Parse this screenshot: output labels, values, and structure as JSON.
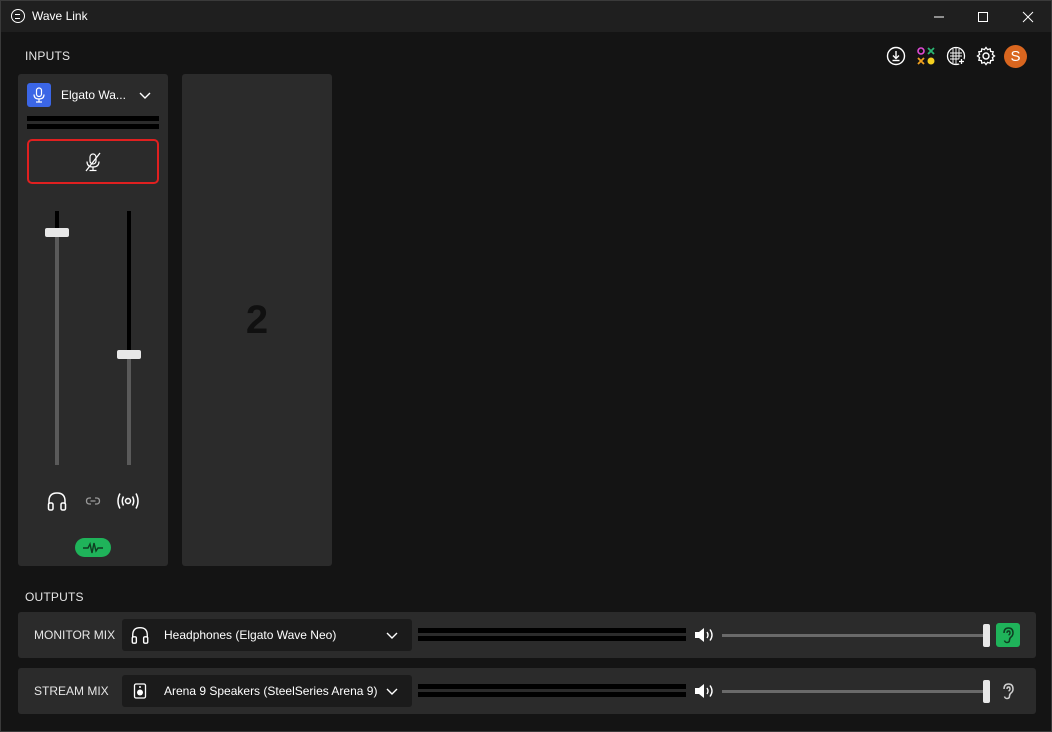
{
  "window": {
    "title": "Wave Link",
    "minimize_icon": "minimize-icon",
    "maximize_icon": "maximize-icon",
    "close_icon": "close-icon"
  },
  "inputs": {
    "section_label": "INPUTS",
    "channels": [
      {
        "name": "Elgato Wa...",
        "icon": "microphone-icon",
        "icon_color": "#3b66e6",
        "muted": true,
        "mute_border_color": "#e02020",
        "monitor_level": 0.92,
        "stream_level": 0.43,
        "monitor_icon": "headphones-icon",
        "link_icon": "link-icon",
        "stream_icon": "broadcast-icon",
        "effects_icon": "waveform-icon",
        "effects_color": "#1fb35a"
      }
    ],
    "empty_slot_label": "2"
  },
  "toolbar": {
    "icons": [
      "download-icon",
      "marketplace-icon",
      "add-input-icon",
      "settings-icon"
    ],
    "avatar_initial": "S",
    "avatar_color": "#d9661f"
  },
  "outputs": {
    "section_label": "OUTPUTS",
    "mixes": [
      {
        "label": "MONITOR MIX",
        "device": "Headphones (Elgato Wave Neo)",
        "device_icon": "headphones-icon",
        "volume_level": 1.0,
        "listening": true,
        "listen_color": "#1fb35a"
      },
      {
        "label": "STREAM MIX",
        "device": "Arena 9 Speakers (SteelSeries Arena 9)",
        "device_icon": "speaker-icon",
        "volume_level": 1.0,
        "listening": false
      }
    ]
  }
}
